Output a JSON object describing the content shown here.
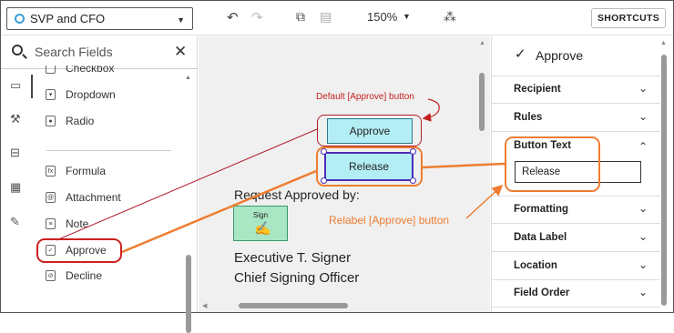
{
  "toolbar": {
    "signer": "SVP and CFO",
    "zoom": "150%",
    "shortcuts_label": "SHORTCUTS"
  },
  "fields_panel": {
    "search_placeholder": "Search Fields",
    "items": [
      {
        "label": "Checkbox",
        "icon": "checkbox-icon"
      },
      {
        "label": "Dropdown",
        "icon": "dropdown-icon"
      },
      {
        "label": "Radio",
        "icon": "radio-icon"
      },
      {
        "label": "Formula",
        "icon": "formula-icon"
      },
      {
        "label": "Attachment",
        "icon": "attachment-icon"
      },
      {
        "label": "Note",
        "icon": "note-icon"
      },
      {
        "label": "Approve",
        "icon": "approve-icon"
      },
      {
        "label": "Decline",
        "icon": "decline-icon"
      }
    ]
  },
  "canvas": {
    "approve_button": "Approve",
    "release_button": "Release",
    "request_text": "Request Approved by:",
    "sign_label": "Sign",
    "signer_name": "Executive T. Signer",
    "signer_title": "Chief Signing Officer"
  },
  "properties": {
    "title": "Approve",
    "sections": [
      "Recipient",
      "Rules",
      "Button Text",
      "Formatting",
      "Data Label",
      "Location",
      "Field Order"
    ],
    "button_text_value": "Release"
  },
  "annotations": {
    "default_label": "Default [Approve] button",
    "relabel_label": "Relabel [Approve] button"
  },
  "colors": {
    "accent_red": "#cc2020",
    "accent_orange": "#ed7d31",
    "button_fill": "#b3eef5",
    "selected_border": "#4b2fb8",
    "sign_fill": "#a8e6c4"
  }
}
